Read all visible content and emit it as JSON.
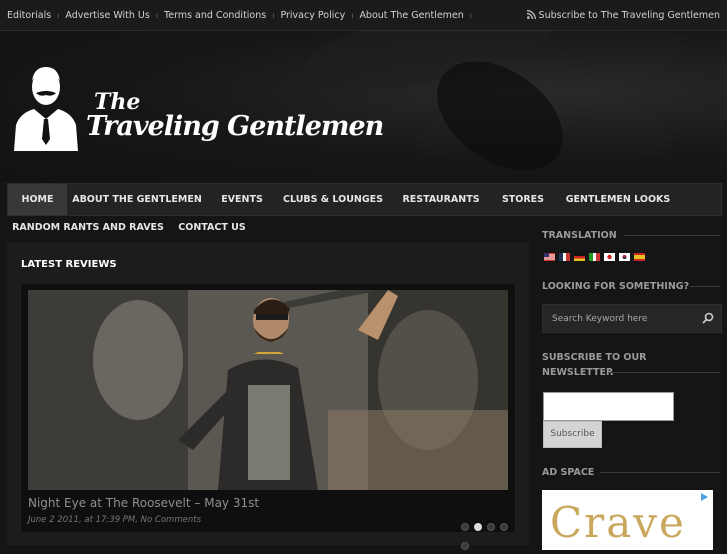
{
  "topbar": {
    "links": [
      "Editorials",
      "Advertise With Us",
      "Terms and Conditions",
      "Privacy Policy",
      "About The Gentlemen"
    ],
    "subscribe": "Subscribe to The Traveling Gentlemen"
  },
  "logo": {
    "line1": "The",
    "line2": "Traveling Gentlemen"
  },
  "nav": {
    "row1": [
      "HOME",
      "ABOUT THE GENTLEMEN",
      "EVENTS",
      "CLUBS & LOUNGES",
      "RESTAURANTS",
      "STORES",
      "GENTLEMEN LOOKS"
    ],
    "row2": [
      "RANDOM RANTS AND RAVES",
      "CONTACT US"
    ],
    "active": "HOME"
  },
  "main": {
    "title": "LATEST REVIEWS",
    "slide_caption": "Night Eye at The Roosevelt – May 31st",
    "slide_meta": "June 2 2011, at 17:39 PM, No Comments",
    "slide_count": 5,
    "active_slide": 2
  },
  "sidebar": {
    "translation_title": "TRANSLATION",
    "flags": [
      "us-flag-icon",
      "fr-flag-icon",
      "de-flag-icon",
      "it-flag-icon",
      "jp-flag-icon",
      "kr-flag-icon",
      "es-flag-icon"
    ],
    "search_title": "LOOKING FOR SOMETHING?",
    "search_placeholder": "Search Keyword here",
    "newsletter_title_1": "SUBSCRIBE TO OUR",
    "newsletter_title_2": "NEWSLETTER",
    "newsletter_value": "",
    "subscribe_button": "Subscribe",
    "ad_title": "AD SPACE",
    "ad_text": "Crave"
  },
  "colors": {
    "background": "#151515",
    "nav": "#232323",
    "nav_active": "#383838",
    "ad_gold": "#c9a85e"
  }
}
